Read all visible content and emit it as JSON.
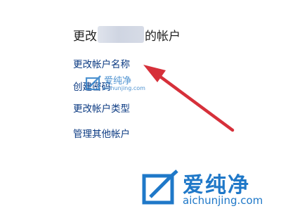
{
  "heading": {
    "prefix": "更改",
    "suffix": "的帐户"
  },
  "links": [
    {
      "label": "更改帐户名称"
    },
    {
      "label": "创建密码"
    },
    {
      "label": "更改帐户类型"
    },
    {
      "label": "管理其他帐户"
    }
  ],
  "watermark_small": {
    "text": "爱纯净",
    "url": "aichunjing.com"
  },
  "watermark_big": {
    "text": "爱纯净",
    "url": "aichunjing.com"
  },
  "colors": {
    "link": "#0b3a82",
    "arrow": "#d6303a",
    "watermark": "#1f78c8"
  }
}
